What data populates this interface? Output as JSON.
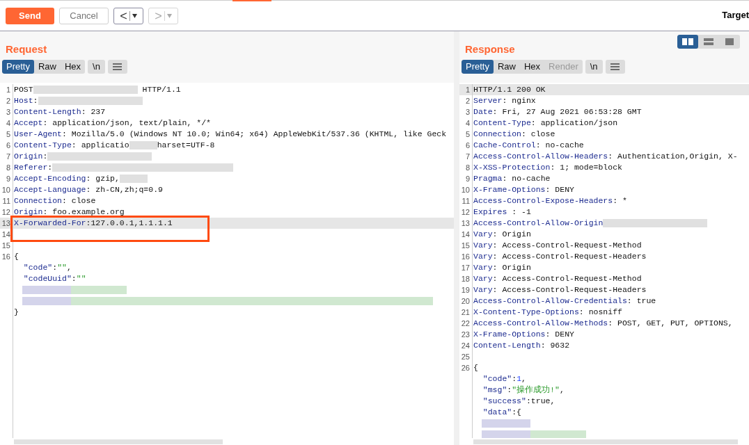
{
  "toolbar": {
    "send": "Send",
    "cancel": "Cancel",
    "back": {
      "label": "<",
      "disabled": false
    },
    "forward": {
      "label": ">",
      "disabled": true
    },
    "target": "Target"
  },
  "layout_toggles": [
    {
      "kind": "columns",
      "selected": true
    },
    {
      "kind": "rows",
      "selected": false
    },
    {
      "kind": "single",
      "selected": false
    }
  ],
  "panes": [
    {
      "title": "Request",
      "view_tabs": [
        {
          "label": "Pretty",
          "selected": true,
          "disabled": false
        },
        {
          "label": "Raw",
          "selected": false,
          "disabled": false
        },
        {
          "label": "Hex",
          "selected": false,
          "disabled": false
        }
      ],
      "newline_button": "\\n",
      "lines": [
        {
          "number": "1",
          "highlighted": false,
          "boxed": false,
          "segments": [
            {
              "kind": "plain",
              "text": "POST"
            },
            {
              "kind": "redacted"
            },
            {
              "kind": "plain",
              "text": " HTTP/1.1"
            }
          ]
        },
        {
          "number": "2",
          "highlighted": false,
          "boxed": false,
          "segments": [
            {
              "kind": "key",
              "text": "Host"
            },
            {
              "kind": "plain",
              "text": ":"
            },
            {
              "kind": "redacted"
            }
          ]
        },
        {
          "number": "3",
          "highlighted": false,
          "boxed": false,
          "segments": [
            {
              "kind": "key",
              "text": "Content-Length"
            },
            {
              "kind": "plain",
              "text": ": 237"
            }
          ]
        },
        {
          "number": "4",
          "highlighted": false,
          "boxed": false,
          "segments": [
            {
              "kind": "key",
              "text": "Accept"
            },
            {
              "kind": "plain",
              "text": ": application/json, text/plain, */*"
            }
          ]
        },
        {
          "number": "5",
          "highlighted": false,
          "boxed": false,
          "segments": [
            {
              "kind": "key",
              "text": "User-Agent"
            },
            {
              "kind": "plain",
              "text": ": Mozilla/5.0 (Windows NT 10.0; Win64; x64) AppleWebKit/537.36 (KHTML, like Geck"
            }
          ]
        },
        {
          "number": "6",
          "highlighted": false,
          "boxed": false,
          "segments": [
            {
              "kind": "key",
              "text": "Content-Type"
            },
            {
              "kind": "plain",
              "text": ": applicatio"
            },
            {
              "kind": "redacted_short"
            },
            {
              "kind": "plain",
              "text": "harset=UTF-8"
            }
          ]
        },
        {
          "number": "7",
          "highlighted": false,
          "boxed": false,
          "segments": [
            {
              "kind": "key",
              "text": "Origin"
            },
            {
              "kind": "plain",
              "text": ":"
            },
            {
              "kind": "redacted"
            }
          ]
        },
        {
          "number": "8",
          "highlighted": false,
          "boxed": false,
          "segments": [
            {
              "kind": "key",
              "text": "Referer"
            },
            {
              "kind": "plain",
              "text": ":"
            },
            {
              "kind": "redacted_wide"
            }
          ]
        },
        {
          "number": "9",
          "highlighted": false,
          "boxed": false,
          "segments": [
            {
              "kind": "key",
              "text": "Accept-Encoding"
            },
            {
              "kind": "plain",
              "text": ": gzip,"
            },
            {
              "kind": "redacted_short"
            }
          ]
        },
        {
          "number": "10",
          "highlighted": false,
          "boxed": false,
          "segments": [
            {
              "kind": "key",
              "text": "Accept-Language"
            },
            {
              "kind": "plain",
              "text": ": zh-CN,zh;q=0.9"
            }
          ]
        },
        {
          "number": "11",
          "highlighted": false,
          "boxed": false,
          "segments": [
            {
              "kind": "key",
              "text": "Connection"
            },
            {
              "kind": "plain",
              "text": ": close"
            }
          ]
        },
        {
          "number": "12",
          "highlighted": false,
          "boxed": false,
          "segments": [
            {
              "kind": "key",
              "text": "Origin"
            },
            {
              "kind": "plain",
              "text": ": foo.example.org"
            }
          ]
        },
        {
          "number": "13",
          "highlighted": true,
          "boxed": true,
          "segments": [
            {
              "kind": "key",
              "text": "X-Forwarded-For"
            },
            {
              "kind": "plain",
              "text": ":127.0.0.1,1.1.1.1"
            }
          ]
        },
        {
          "number": "14",
          "highlighted": false,
          "boxed": true
        },
        {
          "number": "15",
          "highlighted": false,
          "boxed": false
        },
        {
          "number": "16",
          "highlighted": false,
          "boxed": false,
          "segments": [
            {
              "kind": "plain",
              "text": "{"
            }
          ]
        },
        {
          "highlighted": false,
          "boxed": false,
          "segments": [
            {
              "kind": "key",
              "text": "  \"code\""
            },
            {
              "kind": "plain",
              "text": ":"
            },
            {
              "kind": "string",
              "text": "\"\""
            },
            {
              "kind": "plain",
              "text": ","
            }
          ]
        },
        {
          "highlighted": false,
          "boxed": false,
          "segments": [
            {
              "kind": "key",
              "text": "  \"codeUuid\""
            },
            {
              "kind": "plain",
              "text": ":"
            },
            {
              "kind": "string",
              "text": "\"\""
            }
          ]
        },
        {
          "highlighted": false,
          "boxed": false,
          "segments": [
            {
              "kind": "redacted_key"
            },
            {
              "kind": "redacted_value"
            }
          ]
        },
        {
          "highlighted": false,
          "boxed": false,
          "segments": [
            {
              "kind": "redacted_key"
            },
            {
              "kind": "redacted_value_wide"
            }
          ]
        },
        {
          "highlighted": false,
          "boxed": false,
          "segments": [
            {
              "kind": "plain",
              "text": "}"
            }
          ]
        }
      ]
    },
    {
      "title": "Response",
      "view_tabs": [
        {
          "label": "Pretty",
          "selected": true,
          "disabled": false
        },
        {
          "label": "Raw",
          "selected": false,
          "disabled": false
        },
        {
          "label": "Hex",
          "selected": false,
          "disabled": false
        },
        {
          "label": "Render",
          "selected": false,
          "disabled": true
        }
      ],
      "newline_button": "\\n",
      "lines": [
        {
          "number": "1",
          "highlighted": true,
          "boxed": false,
          "segments": [
            {
              "kind": "plain",
              "text": "HTTP/1.1 200 OK"
            }
          ]
        },
        {
          "number": "2",
          "highlighted": false,
          "boxed": false,
          "segments": [
            {
              "kind": "key",
              "text": "Server"
            },
            {
              "kind": "plain",
              "text": ": nginx"
            }
          ]
        },
        {
          "number": "3",
          "highlighted": false,
          "boxed": false,
          "segments": [
            {
              "kind": "key",
              "text": "Date"
            },
            {
              "kind": "plain",
              "text": ": Fri, 27 Aug 2021 06:53:28 GMT"
            }
          ]
        },
        {
          "number": "4",
          "highlighted": false,
          "boxed": false,
          "segments": [
            {
              "kind": "key",
              "text": "Content-Type"
            },
            {
              "kind": "plain",
              "text": ": application/json"
            }
          ]
        },
        {
          "number": "5",
          "highlighted": false,
          "boxed": false,
          "segments": [
            {
              "kind": "key",
              "text": "Connection"
            },
            {
              "kind": "plain",
              "text": ": close"
            }
          ]
        },
        {
          "number": "6",
          "highlighted": false,
          "boxed": false,
          "segments": [
            {
              "kind": "key",
              "text": "Cache-Control"
            },
            {
              "kind": "plain",
              "text": ": no-cache"
            }
          ]
        },
        {
          "number": "7",
          "highlighted": false,
          "boxed": false,
          "segments": [
            {
              "kind": "key",
              "text": "Access-Control-Allow-Headers"
            },
            {
              "kind": "plain",
              "text": ": Authentication,Origin, X-"
            }
          ]
        },
        {
          "number": "8",
          "highlighted": false,
          "boxed": false,
          "segments": [
            {
              "kind": "key",
              "text": "X-XSS-Protection"
            },
            {
              "kind": "plain",
              "text": ": 1; mode=block"
            }
          ]
        },
        {
          "number": "9",
          "highlighted": false,
          "boxed": false,
          "segments": [
            {
              "kind": "key",
              "text": "Pragma"
            },
            {
              "kind": "plain",
              "text": ": no-cache"
            }
          ]
        },
        {
          "number": "10",
          "highlighted": false,
          "boxed": false,
          "segments": [
            {
              "kind": "key",
              "text": "X-Frame-Options"
            },
            {
              "kind": "plain",
              "text": ": DENY"
            }
          ]
        },
        {
          "number": "11",
          "highlighted": false,
          "boxed": false,
          "segments": [
            {
              "kind": "key",
              "text": "Access-Control-Expose-Headers"
            },
            {
              "kind": "plain",
              "text": ": *"
            }
          ]
        },
        {
          "number": "12",
          "highlighted": false,
          "boxed": false,
          "segments": [
            {
              "kind": "key",
              "text": "Expires"
            },
            {
              "kind": "plain",
              "text": " : -1"
            }
          ]
        },
        {
          "number": "13",
          "highlighted": false,
          "boxed": false,
          "segments": [
            {
              "kind": "key",
              "text": "Access-Control-Allow-Origin"
            },
            {
              "kind": "redacted"
            }
          ]
        },
        {
          "number": "14",
          "highlighted": false,
          "boxed": false,
          "segments": [
            {
              "kind": "key",
              "text": "Vary"
            },
            {
              "kind": "plain",
              "text": ": Origin"
            }
          ]
        },
        {
          "number": "15",
          "highlighted": false,
          "boxed": false,
          "segments": [
            {
              "kind": "key",
              "text": "Vary"
            },
            {
              "kind": "plain",
              "text": ": Access-Control-Request-Method"
            }
          ]
        },
        {
          "number": "16",
          "highlighted": false,
          "boxed": false,
          "segments": [
            {
              "kind": "key",
              "text": "Vary"
            },
            {
              "kind": "plain",
              "text": ": Access-Control-Request-Headers"
            }
          ]
        },
        {
          "number": "17",
          "highlighted": false,
          "boxed": false,
          "segments": [
            {
              "kind": "key",
              "text": "Vary"
            },
            {
              "kind": "plain",
              "text": ": Origin"
            }
          ]
        },
        {
          "number": "18",
          "highlighted": false,
          "boxed": false,
          "segments": [
            {
              "kind": "key",
              "text": "Vary"
            },
            {
              "kind": "plain",
              "text": ": Access-Control-Request-Method"
            }
          ]
        },
        {
          "number": "19",
          "highlighted": false,
          "boxed": false,
          "segments": [
            {
              "kind": "key",
              "text": "Vary"
            },
            {
              "kind": "plain",
              "text": ": Access-Control-Request-Headers"
            }
          ]
        },
        {
          "number": "20",
          "highlighted": false,
          "boxed": false,
          "segments": [
            {
              "kind": "key",
              "text": "Access-Control-Allow-Credentials"
            },
            {
              "kind": "plain",
              "text": ": true"
            }
          ]
        },
        {
          "number": "21",
          "highlighted": false,
          "boxed": false,
          "segments": [
            {
              "kind": "key",
              "text": "X-Content-Type-Options"
            },
            {
              "kind": "plain",
              "text": ": nosniff"
            }
          ]
        },
        {
          "number": "22",
          "highlighted": false,
          "boxed": false,
          "segments": [
            {
              "kind": "key",
              "text": "Access-Control-Allow-Methods"
            },
            {
              "kind": "plain",
              "text": ": POST, GET, PUT, OPTIONS,"
            }
          ]
        },
        {
          "number": "23",
          "highlighted": false,
          "boxed": false,
          "segments": [
            {
              "kind": "key",
              "text": "X-Frame-Options"
            },
            {
              "kind": "plain",
              "text": ": DENY"
            }
          ]
        },
        {
          "number": "24",
          "highlighted": false,
          "boxed": false,
          "segments": [
            {
              "kind": "key",
              "text": "Content-Length"
            },
            {
              "kind": "plain",
              "text": ": 9632"
            }
          ]
        },
        {
          "number": "25",
          "highlighted": false,
          "boxed": false
        },
        {
          "number": "26",
          "highlighted": false,
          "boxed": false,
          "segments": [
            {
              "kind": "plain",
              "text": "{"
            }
          ]
        },
        {
          "highlighted": false,
          "boxed": false,
          "segments": [
            {
              "kind": "key",
              "text": "  \"code\""
            },
            {
              "kind": "plain",
              "text": ":"
            },
            {
              "kind": "number",
              "text": "1"
            },
            {
              "kind": "plain",
              "text": ","
            }
          ]
        },
        {
          "highlighted": false,
          "boxed": false,
          "segments": [
            {
              "kind": "key",
              "text": "  \"msg\""
            },
            {
              "kind": "plain",
              "text": ":"
            },
            {
              "kind": "string",
              "text": "\"操作成功!\""
            },
            {
              "kind": "plain",
              "text": ","
            }
          ]
        },
        {
          "highlighted": false,
          "boxed": false,
          "segments": [
            {
              "kind": "key",
              "text": "  \"success\""
            },
            {
              "kind": "plain",
              "text": ":true,"
            }
          ]
        },
        {
          "highlighted": false,
          "boxed": false,
          "segments": [
            {
              "kind": "key",
              "text": "  \"data\""
            },
            {
              "kind": "plain",
              "text": ":{"
            }
          ]
        },
        {
          "highlighted": false,
          "boxed": false,
          "segments": [
            {
              "kind": "redacted_key"
            }
          ]
        },
        {
          "highlighted": false,
          "boxed": false,
          "segments": [
            {
              "kind": "redacted_key"
            },
            {
              "kind": "redacted_value"
            }
          ]
        }
      ]
    }
  ]
}
